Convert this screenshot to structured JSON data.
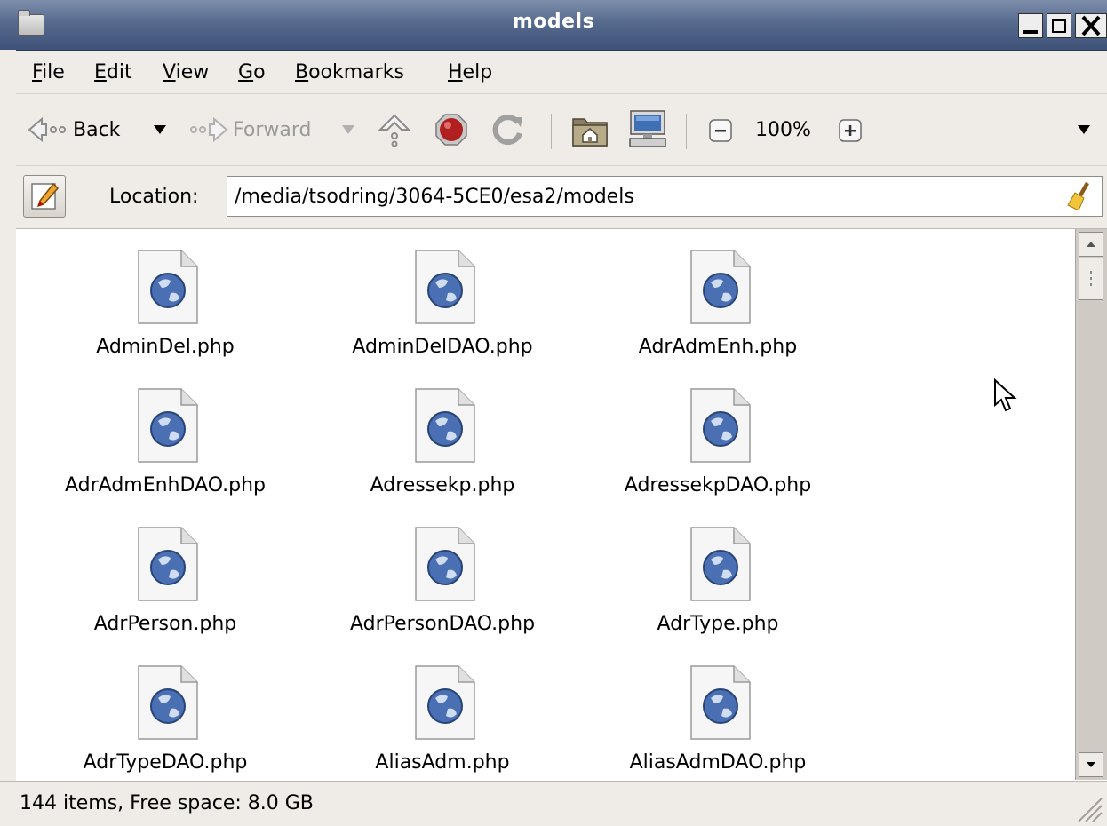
{
  "window": {
    "title": "models"
  },
  "menu": {
    "items": [
      {
        "mnemonic": "F",
        "rest": "ile"
      },
      {
        "mnemonic": "E",
        "rest": "dit"
      },
      {
        "mnemonic": "V",
        "rest": "iew"
      },
      {
        "mnemonic": "G",
        "rest": "o"
      },
      {
        "mnemonic": "B",
        "rest": "ookmarks"
      },
      {
        "mnemonic": "H",
        "rest": "elp"
      }
    ]
  },
  "toolbar": {
    "back_label": "Back",
    "forward_label": "Forward",
    "zoom_level": "100%"
  },
  "location": {
    "label": "Location:",
    "value": "/media/tsodring/3064-5CE0/esa2/models"
  },
  "files": [
    {
      "name": "AdminDel.php"
    },
    {
      "name": "AdminDelDAO.php"
    },
    {
      "name": "AdrAdmEnh.php"
    },
    {
      "name": "AdrAdmEnhDAO.php"
    },
    {
      "name": "Adressekp.php"
    },
    {
      "name": "AdressekpDAO.php"
    },
    {
      "name": "AdrPerson.php"
    },
    {
      "name": "AdrPersonDAO.php"
    },
    {
      "name": "AdrType.php"
    },
    {
      "name": "AdrTypeDAO.php"
    },
    {
      "name": "AliasAdm.php"
    },
    {
      "name": "AliasAdmDAO.php"
    }
  ],
  "status": {
    "text": "144 items, Free space: 8.0 GB"
  },
  "colors": {
    "titlebar": "#566a8e",
    "chrome": "#efebe7",
    "icon_globe": "#4a6fb3"
  }
}
